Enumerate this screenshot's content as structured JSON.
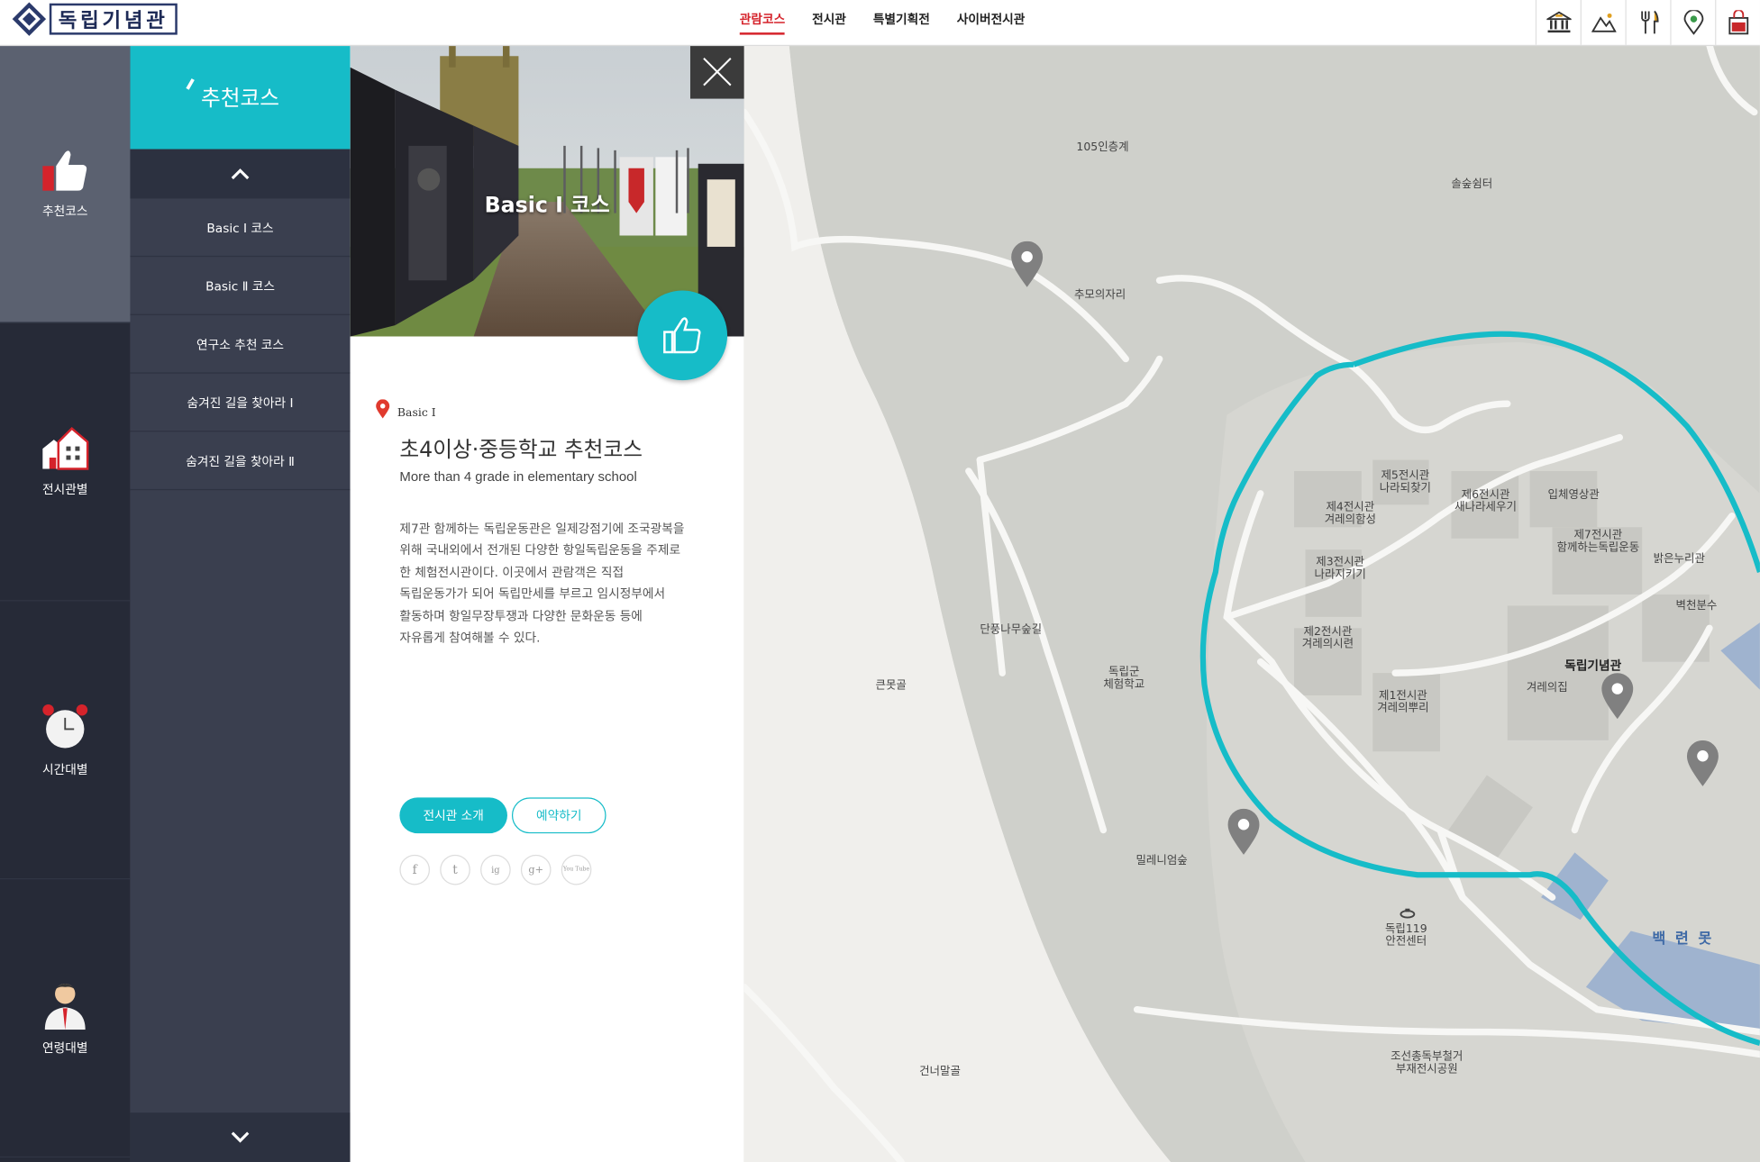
{
  "header": {
    "logo_text": "독립기념관",
    "nav": [
      "관람코스",
      "전시관",
      "특별기획전",
      "사이버전시관"
    ],
    "utility_icons": [
      "museum-icon",
      "mountain-icon",
      "restaurant-icon",
      "location-icon",
      "shopping-bag-icon"
    ]
  },
  "rail": {
    "items": [
      {
        "label": "추천코스",
        "icon": "thumbs-up-icon"
      },
      {
        "label": "전시관별",
        "icon": "building-icon"
      },
      {
        "label": "시간대별",
        "icon": "alarm-clock-icon"
      },
      {
        "label": "연령대별",
        "icon": "person-icon"
      }
    ]
  },
  "submenu": {
    "title": "추천코스",
    "items": [
      "Basic Ⅰ  코스",
      "Basic Ⅱ 코스",
      "연구소 추천 코스",
      "숨겨진 길을 찾아라 Ⅰ",
      "숨겨진 길을 찾아라 Ⅱ"
    ]
  },
  "panel": {
    "photo_title": "Basic Ⅰ  코스",
    "tag": "Basic Ⅰ",
    "title": "초4이상·중등학교 추천코스",
    "subtitle": "More than 4 grade in elementary school",
    "description": [
      "제7관 함께하는 독립운동관은 일제강점기에 조국광복을",
      "위해 국내외에서 전개된 다양한 항일독립운동을 주제로",
      "한 체험전시관이다. 이곳에서 관람객은 직접",
      "독립운동가가 되어 독립만세를 부르고 임시정부에서",
      "활동하며 항일무장투쟁과 다양한 문화운동 등에",
      "자유롭게 참여해볼 수 있다."
    ],
    "btn_intro": "전시관 소개",
    "btn_reserve": "예약하기",
    "social": [
      "f",
      "t",
      "ig",
      "g+",
      "You Tube"
    ]
  },
  "map": {
    "labels": [
      {
        "text": "105인층계"
      },
      {
        "text": "솔숲쉼터"
      },
      {
        "text": "추모의자리"
      },
      {
        "text": "제5전시관\n나라되찾기"
      },
      {
        "text": "제6전시관\n새나라세우기"
      },
      {
        "text": "입체영상관"
      },
      {
        "text": "제4전시관\n겨레의함성"
      },
      {
        "text": "제7전시관\n함께하는독립운동"
      },
      {
        "text": "밝은누리관"
      },
      {
        "text": "제3전시관\n나라지키기"
      },
      {
        "text": "벽천분수"
      },
      {
        "text": "단풍나무숲길"
      },
      {
        "text": "제2전시관\n겨레의시련"
      },
      {
        "text": "독립기념관"
      },
      {
        "text": "큰못골"
      },
      {
        "text": "독립군\n체험학교"
      },
      {
        "text": "겨레의집"
      },
      {
        "text": "제1전시관\n겨레의뿌리"
      },
      {
        "text": "밀레니엄숲"
      },
      {
        "text": "독립119\n안전센터"
      },
      {
        "text": "백 련 못"
      },
      {
        "text": "조선총독부철거\n부재전시공원"
      },
      {
        "text": "건너말골"
      }
    ]
  },
  "colors": {
    "accent": "#16bcc8",
    "nav_active": "#d5232b",
    "rail_bg": "#262a37",
    "submenu_bg": "#3a3f4f"
  }
}
